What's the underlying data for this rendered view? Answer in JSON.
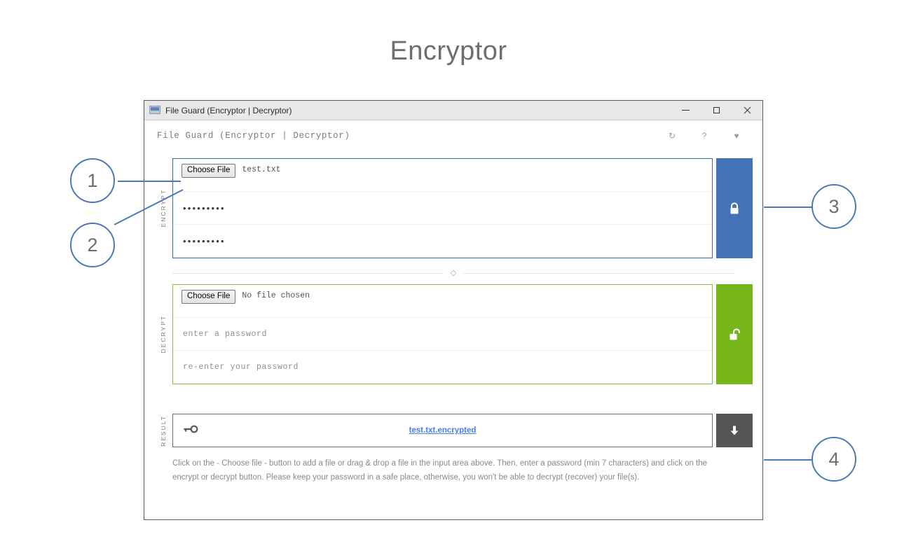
{
  "page": {
    "title": "Encryptor"
  },
  "window": {
    "titlebar": {
      "icon": "app-window-icon",
      "title": "File Guard (Encryptor | Decryptor)",
      "minimize": "–",
      "maximize": "□",
      "close": "×"
    },
    "header": {
      "title": "File Guard (Encryptor | Decryptor)",
      "icons": [
        {
          "name": "refresh-icon",
          "glyph": "↻"
        },
        {
          "name": "help-icon",
          "glyph": "?"
        },
        {
          "name": "heart-icon",
          "glyph": "♥"
        }
      ]
    }
  },
  "encrypt": {
    "label": "ENCRYPT",
    "choose_file_label": "Choose File",
    "file_name": "test.txt",
    "password": "•••••••••",
    "password_confirm": "•••••••••",
    "password_placeholder": "enter a password",
    "password_confirm_placeholder": "re-enter your password",
    "action_icon": "lock-closed-icon",
    "action_color": "#4472b8"
  },
  "divider": {
    "swap_glyph": "◇"
  },
  "decrypt": {
    "label": "DECRYPT",
    "choose_file_label": "Choose File",
    "file_name": "No file chosen",
    "password_placeholder": "enter a password",
    "password_confirm_placeholder": "re-enter your password",
    "action_icon": "lock-open-icon",
    "action_color": "#76b61a"
  },
  "result": {
    "label": "RESULT",
    "key_icon": "key-icon",
    "file_link": "test.txt.encrypted",
    "download_icon": "download-arrow-icon",
    "download_color": "#555555"
  },
  "help": {
    "text": "Click on the - Choose file - button to add a file or drag & drop a file in the input area above. Then, enter a password (min 7 characters) and click on the encrypt or decrypt button. Please keep your password in a safe place, otherwise, you won't be able to decrypt (recover) your file(s)."
  },
  "callouts": [
    {
      "number": "1"
    },
    {
      "number": "2"
    },
    {
      "number": "3"
    },
    {
      "number": "4"
    }
  ],
  "colors": {
    "callout_ring": "#4a7ab4",
    "encrypt_border": "#3c67ad",
    "decrypt_border": "#86c232",
    "link": "#4a7ff0"
  }
}
